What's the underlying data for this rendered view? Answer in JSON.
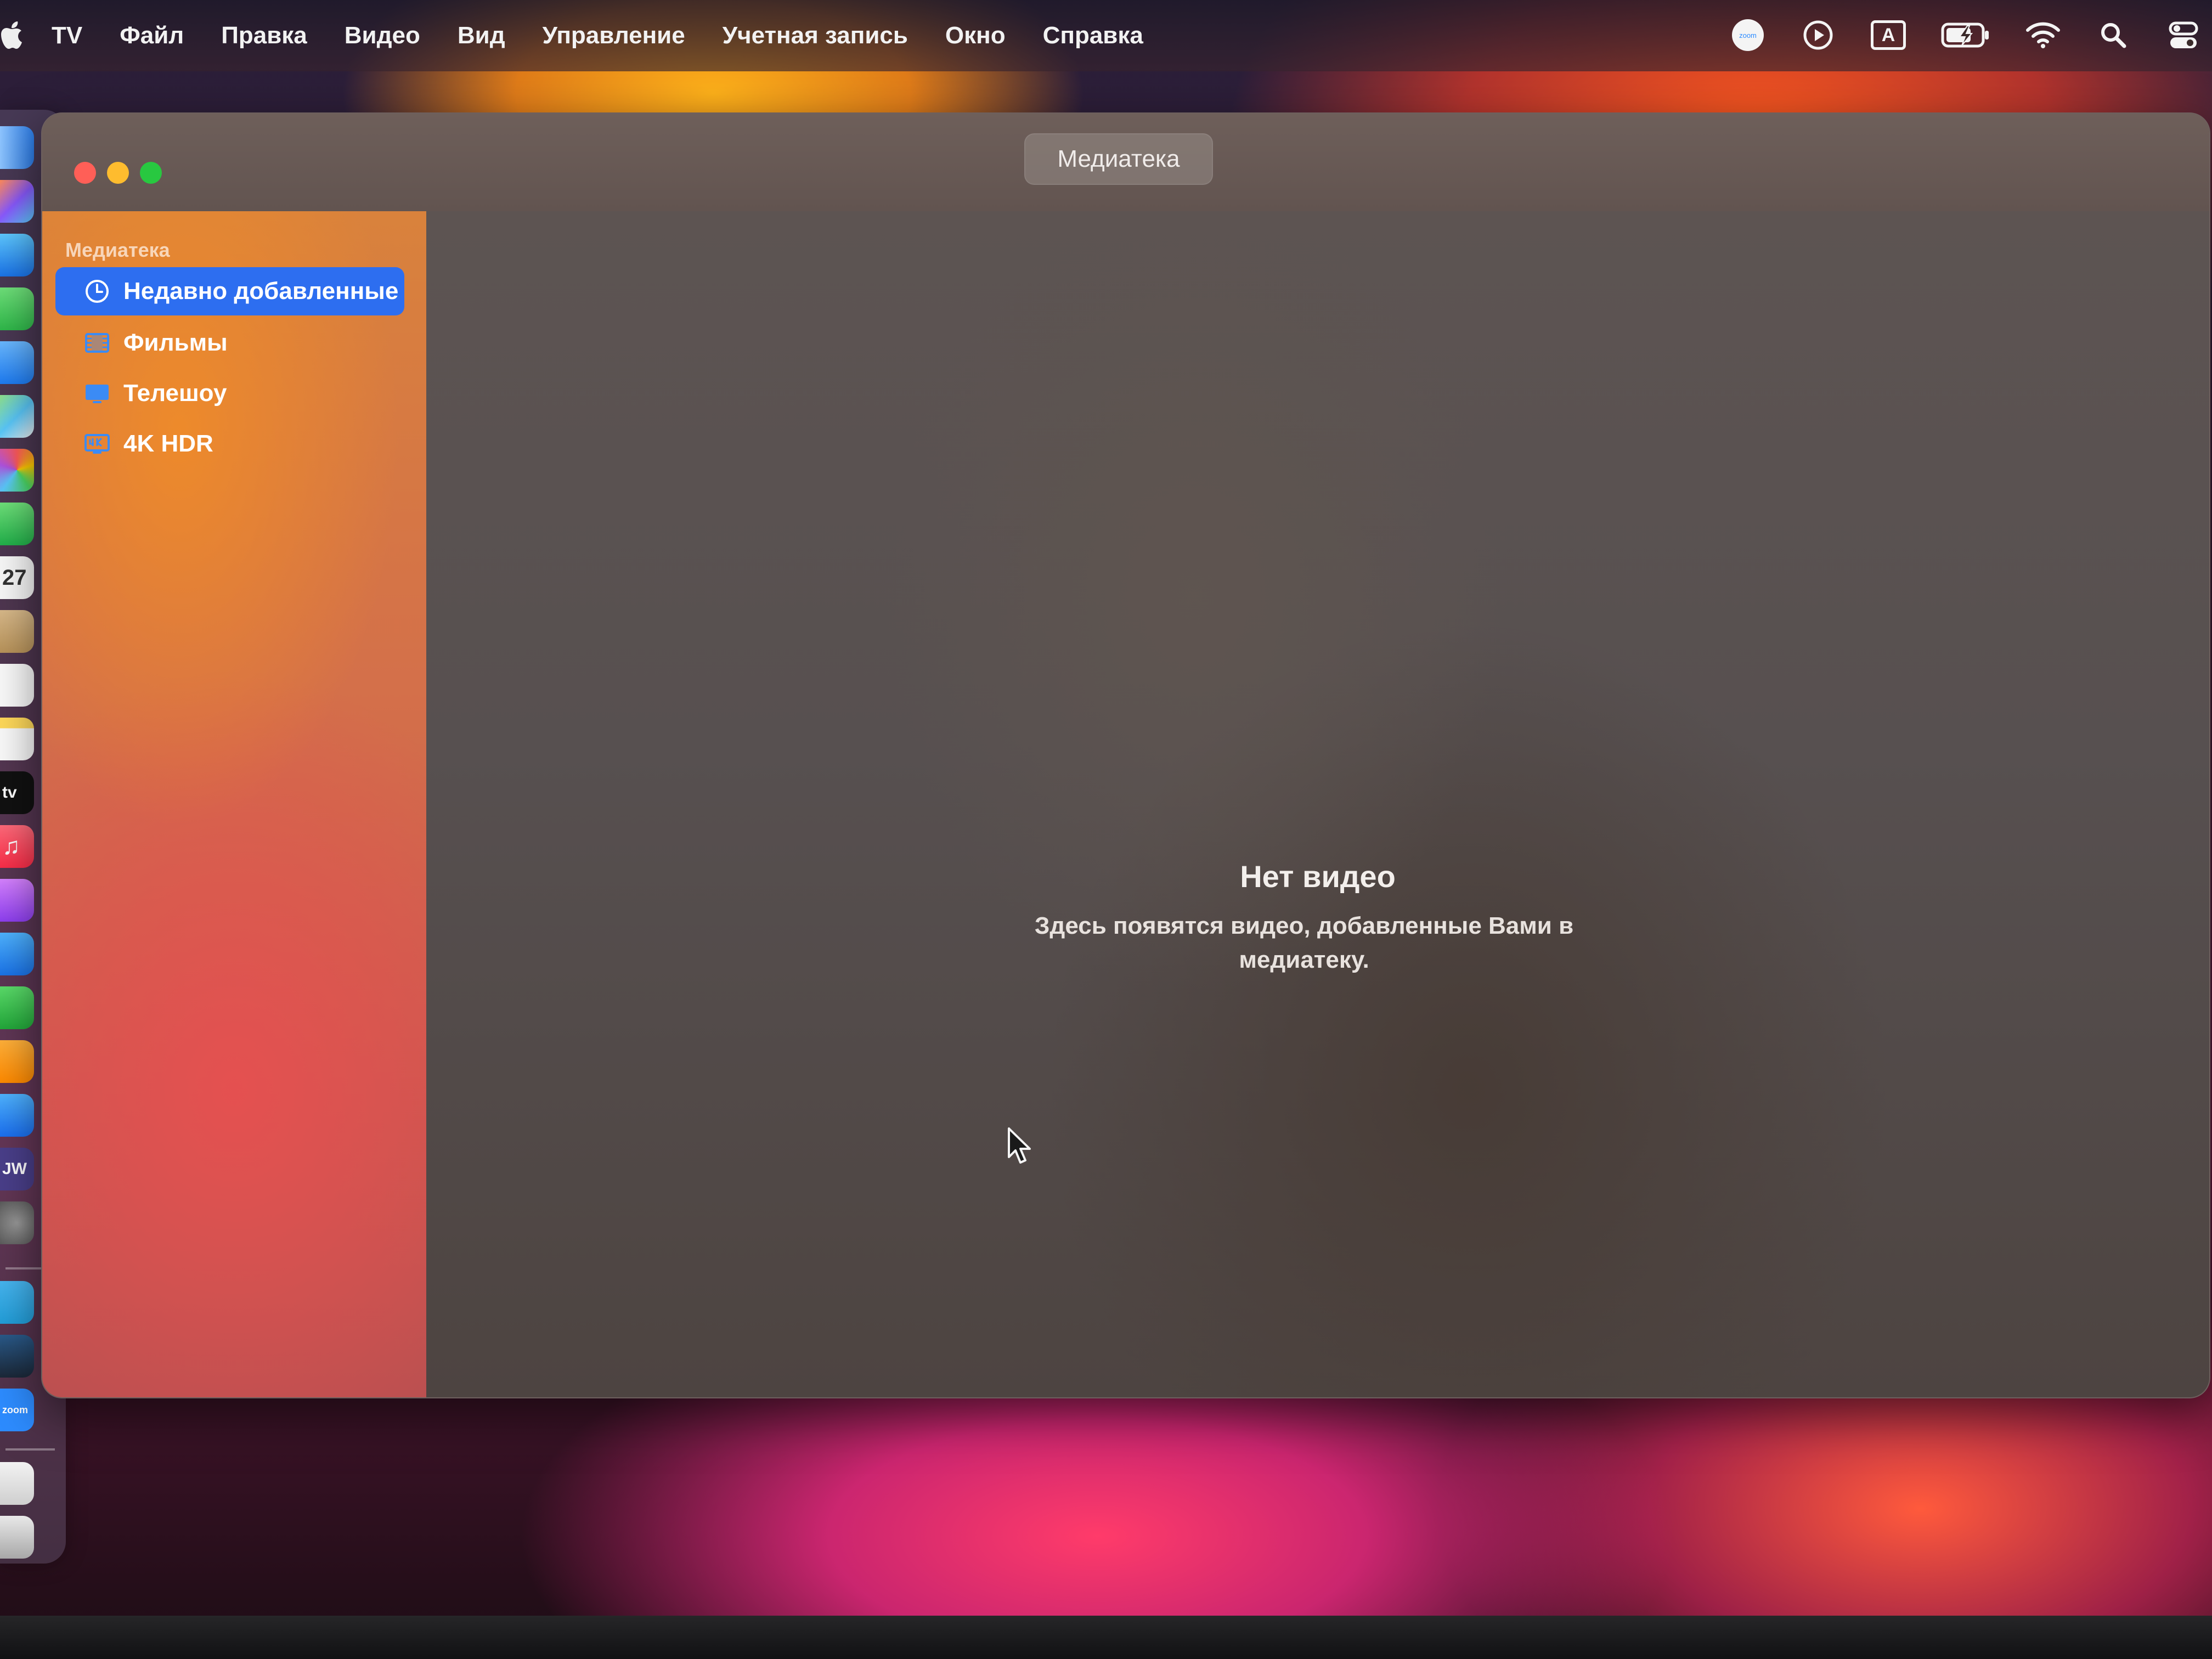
{
  "menubar": {
    "items": [
      "TV",
      "Файл",
      "Правка",
      "Видео",
      "Вид",
      "Управление",
      "Учетная запись",
      "Окно",
      "Справка"
    ],
    "status_icons": [
      "zoom-icon",
      "play-circle-icon",
      "input-source-icon",
      "battery-charging-icon",
      "wifi-icon",
      "search-icon",
      "control-center-icon"
    ],
    "input_source_label": "A",
    "zoom_label": "zoom"
  },
  "dock": {
    "icons": [
      "finder-icon",
      "launchpad-icon",
      "safari-icon",
      "messages-icon",
      "mail-icon",
      "maps-icon",
      "photos-icon",
      "facetime-icon",
      "calendar-icon",
      "contacts-icon",
      "reminders-icon",
      "notes-icon",
      "tv-icon",
      "music-icon",
      "podcasts-icon",
      "keynote-icon",
      "numbers-icon",
      "pages-icon",
      "app-store-icon",
      "jw-library-icon",
      "system-preferences-icon",
      "telegram-icon",
      "steam-icon",
      "zoom-icon",
      "document-icon",
      "trash-icon"
    ],
    "calendar_day": "27",
    "tv_label": "tv",
    "jw_label": "JW",
    "zoom_label": "zoom"
  },
  "window": {
    "title": "Медиатека",
    "sidebar": {
      "heading": "Медиатека",
      "items": [
        {
          "label": "Недавно добавленные",
          "icon": "clock-icon",
          "selected": true
        },
        {
          "label": "Фильмы",
          "icon": "film-icon",
          "selected": false
        },
        {
          "label": "Телешоу",
          "icon": "tv-screen-icon",
          "selected": false
        },
        {
          "label": "4K HDR",
          "icon": "4k-icon",
          "selected": false
        }
      ]
    },
    "empty_state": {
      "title": "Нет видео",
      "subtitle": "Здесь появятся видео, добавленные Вами в медиатеку."
    }
  },
  "colors": {
    "selection": "#2d6ef0",
    "close": "#ff5f57",
    "minimize": "#febc2e",
    "maximize": "#28c840"
  }
}
